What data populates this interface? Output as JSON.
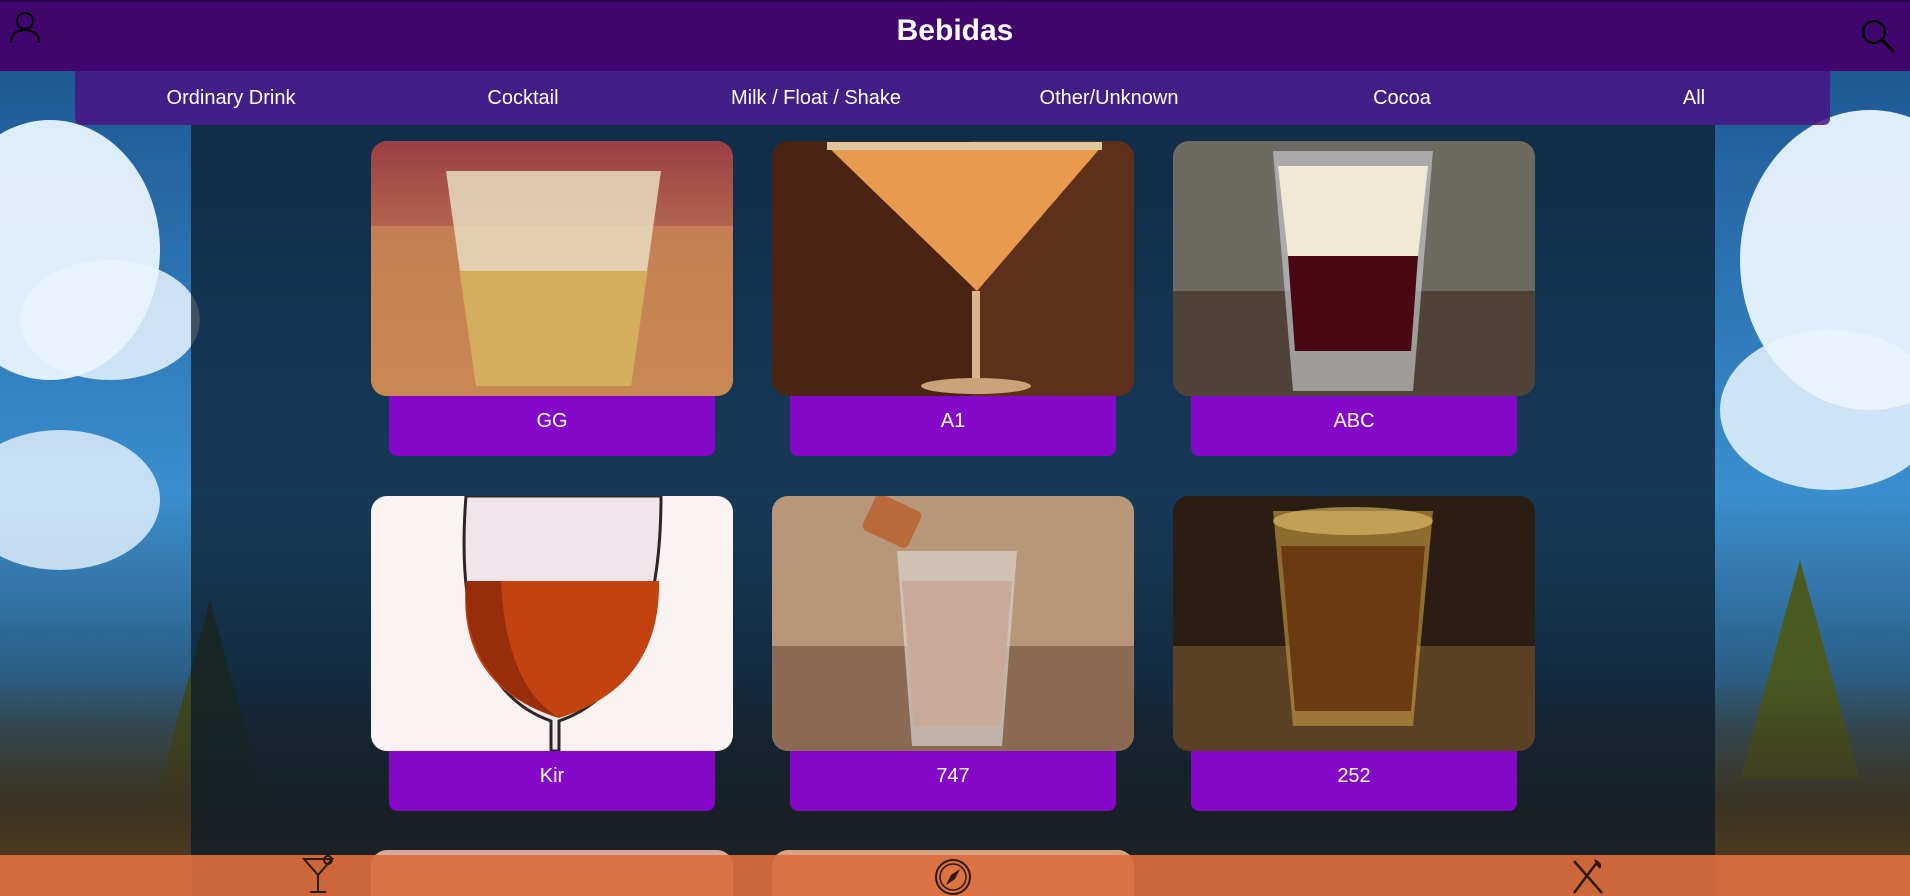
{
  "header": {
    "title": "Bebidas",
    "user_icon": "user-icon",
    "search_icon": "search-icon"
  },
  "categories": [
    "Ordinary Drink",
    "Cocktail",
    "Milk / Float / Shake",
    "Other/Unknown",
    "Cocoa",
    "All"
  ],
  "drinks": [
    {
      "name": "GG"
    },
    {
      "name": "A1"
    },
    {
      "name": "ABC"
    },
    {
      "name": "Kir"
    },
    {
      "name": "747"
    },
    {
      "name": "252"
    }
  ],
  "bottom_nav": {
    "left_icon": "cocktail-icon",
    "center_icon": "compass-icon",
    "right_icon": "utensils-icon"
  },
  "colors": {
    "header": "#40066e",
    "label": "#8308c7",
    "bottom_nav": "#dc6e3c"
  }
}
